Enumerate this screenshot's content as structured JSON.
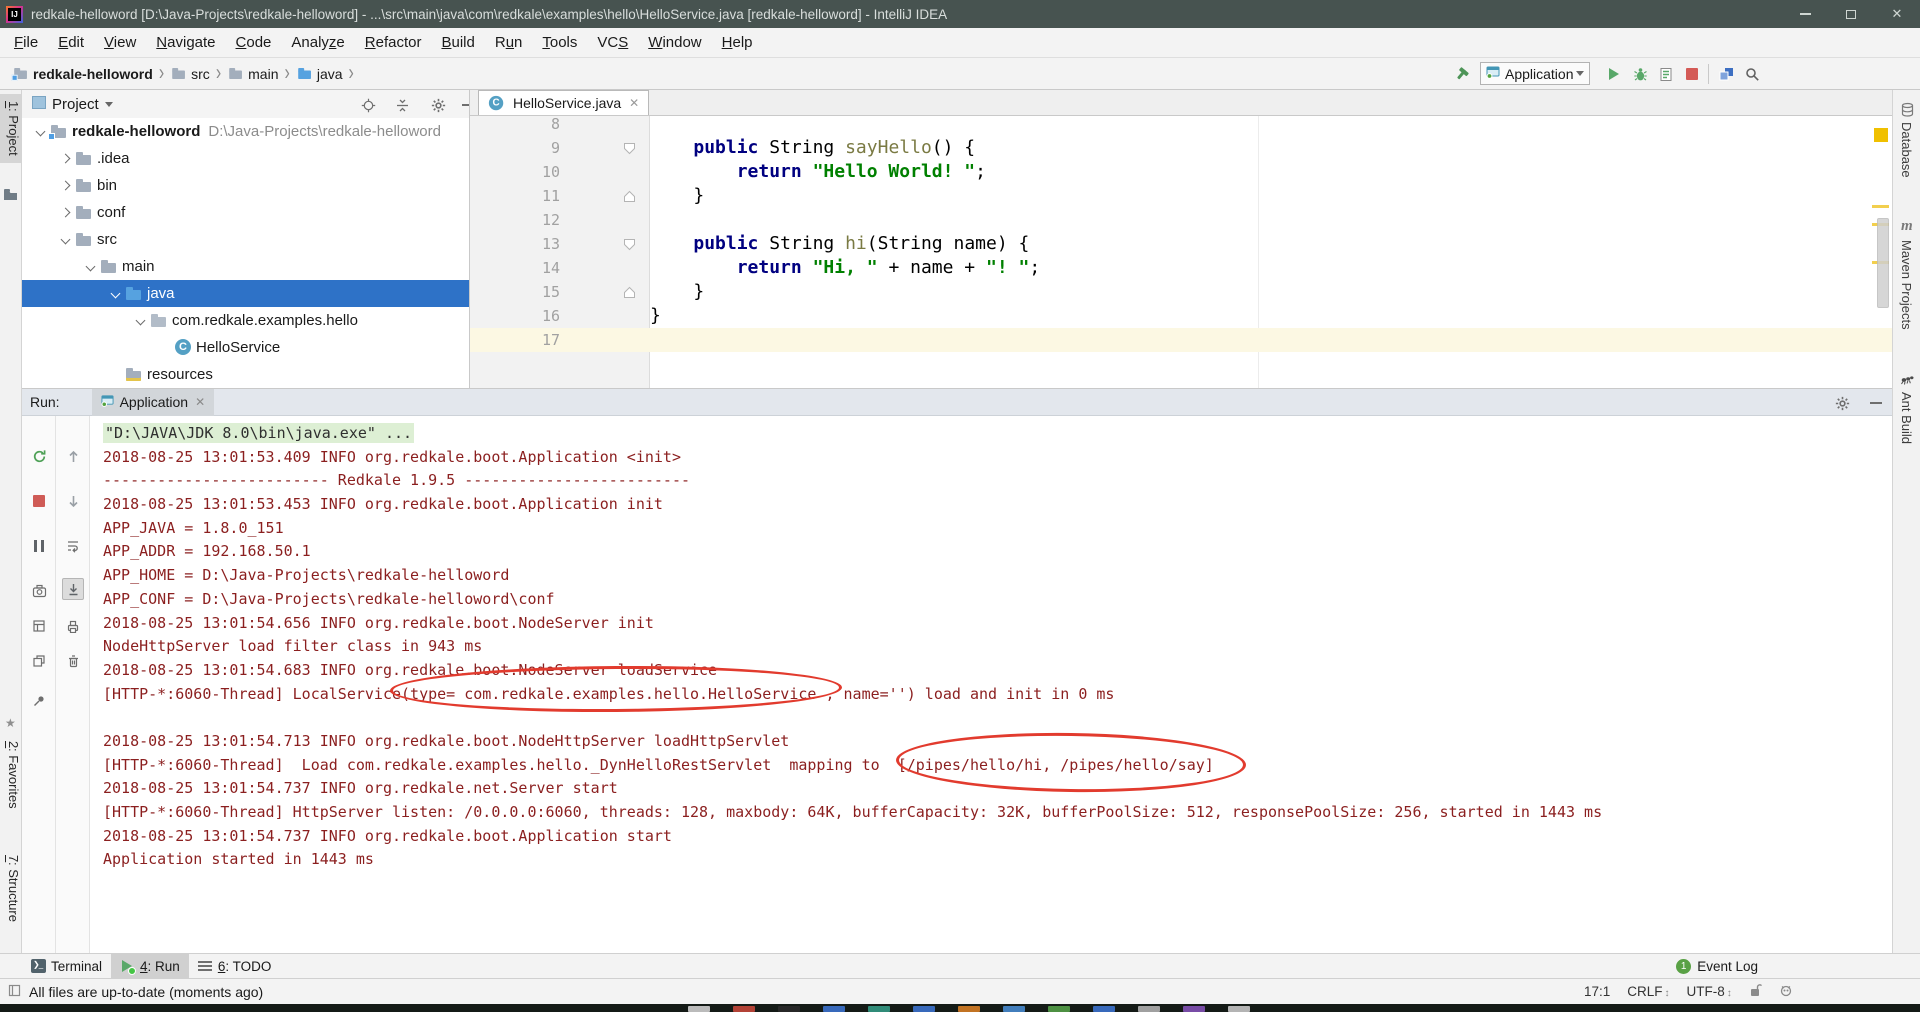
{
  "window": {
    "title": "redkale-helloword [D:\\Java-Projects\\redkale-helloword] - ...\\src\\main\\java\\com\\redkale\\examples\\hello\\HelloService.java [redkale-helloword] - IntelliJ IDEA",
    "controls": [
      "minimize",
      "maximize",
      "close"
    ]
  },
  "menu": {
    "items": [
      {
        "label": "File",
        "u": 0
      },
      {
        "label": "Edit",
        "u": 0
      },
      {
        "label": "View",
        "u": 0
      },
      {
        "label": "Navigate",
        "u": 0
      },
      {
        "label": "Code",
        "u": 0
      },
      {
        "label": "Analyze",
        "u": 5
      },
      {
        "label": "Refactor",
        "u": 0
      },
      {
        "label": "Build",
        "u": 0
      },
      {
        "label": "Run",
        "u": 1
      },
      {
        "label": "Tools",
        "u": 0
      },
      {
        "label": "VCS",
        "u": 2
      },
      {
        "label": "Window",
        "u": 0
      },
      {
        "label": "Help",
        "u": 0
      }
    ]
  },
  "toolbar": {
    "separator": "›",
    "breadcrumbs": [
      {
        "label": "redkale-helloword",
        "icon": "project",
        "bold": true
      },
      {
        "label": "src",
        "icon": "folder"
      },
      {
        "label": "main",
        "icon": "folder"
      },
      {
        "label": "java",
        "icon": "source-folder"
      }
    ],
    "run_config": {
      "label": "Application"
    },
    "icons": [
      "build-hammer-icon",
      "run-icon",
      "debug-icon",
      "coverage-icon",
      "stop-icon",
      "project-structure-icon",
      "search-icon"
    ]
  },
  "strips": {
    "left": [
      {
        "key": "project",
        "label": "1: Project",
        "u": 0,
        "active": true
      },
      {
        "key": "favorites",
        "label": "2: Favorites",
        "u": 0
      },
      {
        "key": "structure",
        "label": "7: Structure",
        "u": 0
      }
    ],
    "right": [
      {
        "key": "database",
        "label": "Database"
      },
      {
        "key": "maven",
        "label": "Maven Projects"
      },
      {
        "key": "ant",
        "label": "Ant Build"
      }
    ]
  },
  "project_panel": {
    "header": {
      "title": "Project"
    },
    "tree": [
      {
        "label": "redkale-helloword",
        "path": "D:\\Java-Projects\\redkale-helloword",
        "level": 0,
        "state": "expanded",
        "icon": "project",
        "bold": true
      },
      {
        "label": ".idea",
        "level": 1,
        "state": "collapsed",
        "icon": "folder"
      },
      {
        "label": "bin",
        "level": 1,
        "state": "collapsed",
        "icon": "folder"
      },
      {
        "label": "conf",
        "level": 1,
        "state": "collapsed",
        "icon": "folder"
      },
      {
        "label": "src",
        "level": 1,
        "state": "expanded",
        "icon": "folder"
      },
      {
        "label": "main",
        "level": 2,
        "state": "expanded",
        "icon": "folder"
      },
      {
        "label": "java",
        "level": 3,
        "state": "expanded",
        "icon": "source-folder",
        "selected": true
      },
      {
        "label": "com.redkale.examples.hello",
        "level": 4,
        "state": "expanded",
        "icon": "package"
      },
      {
        "label": "HelloService",
        "level": 5,
        "state": "none",
        "icon": "class"
      },
      {
        "label": "resources",
        "level": 3,
        "state": "none",
        "icon": "resources-folder"
      }
    ]
  },
  "editor": {
    "tab": {
      "label": "HelloService.java",
      "icon": "class"
    },
    "lines": [
      {
        "n": "8",
        "segments": []
      },
      {
        "n": "9",
        "fold": "down",
        "segments": [
          {
            "t": "    "
          },
          {
            "t": "public",
            "c": "kw"
          },
          {
            "t": " String "
          },
          {
            "t": "sayHello",
            "c": "m"
          },
          {
            "t": "() {"
          }
        ]
      },
      {
        "n": "10",
        "segments": [
          {
            "t": "        "
          },
          {
            "t": "return",
            "c": "kw"
          },
          {
            "t": " "
          },
          {
            "t": "\"Hello World! \"",
            "c": "s"
          },
          {
            "t": ";"
          }
        ]
      },
      {
        "n": "11",
        "fold": "up",
        "segments": [
          {
            "t": "    }"
          }
        ]
      },
      {
        "n": "12",
        "segments": []
      },
      {
        "n": "13",
        "fold": "down",
        "segments": [
          {
            "t": "    "
          },
          {
            "t": "public",
            "c": "kw"
          },
          {
            "t": " String "
          },
          {
            "t": "hi",
            "c": "m"
          },
          {
            "t": "(String name) {"
          }
        ]
      },
      {
        "n": "14",
        "segments": [
          {
            "t": "        "
          },
          {
            "t": "return",
            "c": "kw"
          },
          {
            "t": " "
          },
          {
            "t": "\"Hi, \"",
            "c": "s"
          },
          {
            "t": " + name + "
          },
          {
            "t": "\"! \"",
            "c": "s"
          },
          {
            "t": ";"
          }
        ]
      },
      {
        "n": "15",
        "fold": "up",
        "segments": [
          {
            "t": "    }"
          }
        ]
      },
      {
        "n": "16",
        "segments": [
          {
            "t": "}"
          }
        ]
      },
      {
        "n": "17",
        "caret": true,
        "segments": []
      }
    ]
  },
  "run_panel": {
    "label": "Run:",
    "tab": {
      "label": "Application"
    },
    "console": [
      {
        "text": "\"D:\\JAVA\\JDK 8.0\\bin\\java.exe\" ...",
        "type": "cmd"
      },
      {
        "text": "2018-08-25 13:01:53.409 INFO org.redkale.boot.Application <init>"
      },
      {
        "text": "------------------------- Redkale 1.9.5 -------------------------"
      },
      {
        "text": "2018-08-25 13:01:53.453 INFO org.redkale.boot.Application init"
      },
      {
        "text": "APP_JAVA = 1.8.0_151"
      },
      {
        "text": "APP_ADDR = 192.168.50.1"
      },
      {
        "text": "APP_HOME = D:\\Java-Projects\\redkale-helloword"
      },
      {
        "text": "APP_CONF = D:\\Java-Projects\\redkale-helloword\\conf"
      },
      {
        "text": "2018-08-25 13:01:54.656 INFO org.redkale.boot.NodeServer init"
      },
      {
        "text": "NodeHttpServer load filter class in 943 ms"
      },
      {
        "text": "2018-08-25 13:01:54.683 INFO org.redkale.boot.NodeServer loadService"
      },
      {
        "text": "[HTTP-*:6060-Thread] LocalService(type= com.redkale.examples.hello.HelloService , name='') load and init in 0 ms"
      },
      {
        "text": ""
      },
      {
        "text": "2018-08-25 13:01:54.713 INFO org.redkale.boot.NodeHttpServer loadHttpServlet"
      },
      {
        "text": "[HTTP-*:6060-Thread]  Load com.redkale.examples.hello._DynHelloRestServlet  mapping to  [/pipes/hello/hi, /pipes/hello/say]"
      },
      {
        "text": "2018-08-25 13:01:54.737 INFO org.redkale.net.Server start"
      },
      {
        "text": "[HTTP-*:6060-Thread] HttpServer listen: /0.0.0.0:6060, threads: 128, maxbody: 64K, bufferCapacity: 32K, bufferPoolSize: 512, responsePoolSize: 256, started in 1443 ms"
      },
      {
        "text": "2018-08-25 13:01:54.737 INFO org.redkale.boot.Application start"
      },
      {
        "text": "Application started in 1443 ms"
      }
    ],
    "annotations": [
      "red-ellipse-around-service-type",
      "red-ellipse-around-rest-mappings"
    ]
  },
  "bottom_bar": {
    "tabs": [
      {
        "key": "terminal",
        "label": "Terminal"
      },
      {
        "key": "run",
        "label": "4: Run",
        "u": 0,
        "selected": true
      },
      {
        "key": "todo",
        "label": "6: TODO",
        "u": 0
      }
    ],
    "event_log": {
      "count": "1",
      "label": "Event Log"
    }
  },
  "status_bar": {
    "message": "All files are up-to-date (moments ago)",
    "caret_position": "17:1",
    "line_separator": "CRLF",
    "encoding": "UTF-8"
  },
  "colors": {
    "selection_blue": "#2e72c7",
    "console_log_red": "#8b1f1f",
    "keyword_blue": "#000080",
    "string_green": "#008000",
    "caret_line_yellow": "#fcf8e3",
    "annotation_red": "#e23b2e",
    "run_green": "#59a869",
    "stop_red": "#d45252",
    "marker_yellow": "#f0c000"
  }
}
